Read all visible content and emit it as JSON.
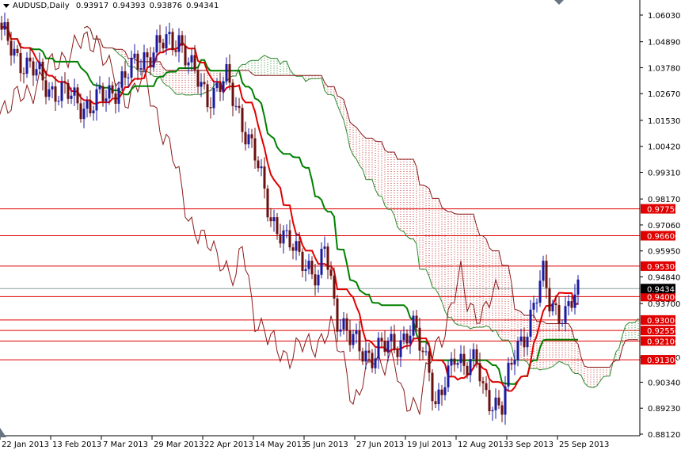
{
  "header": {
    "symbol": "AUDUSD,Daily",
    "open": "0.93917",
    "high": "0.94393",
    "low": "0.93876",
    "close": "0.94341"
  },
  "chart_data": {
    "type": "candlestick",
    "title": "AUDUSD,Daily",
    "indicator": "Ichimoku Kinko Hyo",
    "ylim": [
      0.8812,
      1.0603
    ],
    "y_ticks": [
      "1.06030",
      "1.04890",
      "1.03780",
      "1.02670",
      "1.01530",
      "1.00420",
      "0.99310",
      "0.98170",
      "0.97060",
      "0.95950",
      "0.94840",
      "0.93700",
      "0.91400",
      "0.90340",
      "0.89230",
      "0.88120"
    ],
    "x_labels": [
      "22 Jan 2013",
      "13 Feb 2013",
      "7 Mar 2013",
      "29 Mar 2013",
      "22 Apr 2013",
      "14 May 2013",
      "5 Jun 2013",
      "27 Jun 2013",
      "19 Jul 2013",
      "12 Aug 2013",
      "3 Sep 2013",
      "25 Sep 2013"
    ],
    "bars_per_label": 16,
    "bar_count": 184,
    "close_keypoints": [
      [
        0,
        1.0515
      ],
      [
        5,
        1.043
      ],
      [
        15,
        1.0295
      ],
      [
        28,
        1.021
      ],
      [
        33,
        1.026
      ],
      [
        40,
        1.035
      ],
      [
        45,
        1.043
      ],
      [
        56,
        1.051
      ],
      [
        60,
        1.036
      ],
      [
        65,
        1.026
      ],
      [
        71,
        1.032
      ],
      [
        75,
        1.019
      ],
      [
        80,
        0.999
      ],
      [
        85,
        0.975
      ],
      [
        90,
        0.962
      ],
      [
        95,
        0.958
      ],
      [
        100,
        0.945
      ],
      [
        102,
        0.962
      ],
      [
        106,
        0.932
      ],
      [
        110,
        0.921
      ],
      [
        117,
        0.915
      ],
      [
        125,
        0.921
      ],
      [
        130,
        0.925
      ],
      [
        135,
        0.911
      ],
      [
        137,
        0.894
      ],
      [
        141,
        0.904
      ],
      [
        143,
        0.915
      ],
      [
        150,
        0.911
      ],
      [
        152,
        0.898
      ],
      [
        158,
        0.894
      ],
      [
        162,
        0.915
      ],
      [
        166,
        0.928
      ],
      [
        171,
        0.948
      ],
      [
        173,
        0.938
      ],
      [
        178,
        0.932
      ],
      [
        183,
        0.94341
      ]
    ],
    "last_bar": {
      "open": 0.93917,
      "high": 0.94393,
      "low": 0.93876,
      "close": 0.94341
    },
    "current_price": {
      "value": 0.94341,
      "label": "0.94341",
      "color": "#000000"
    },
    "levels": [
      {
        "value": 0.9775,
        "label": "0.97750"
      },
      {
        "value": 0.966,
        "label": "0.96600"
      },
      {
        "value": 0.953,
        "label": "0.95300"
      },
      {
        "value": 0.94,
        "label": "0.94000"
      },
      {
        "value": 0.93,
        "label": "0.93000"
      },
      {
        "value": 0.9255,
        "label": "0.92550"
      },
      {
        "value": 0.921,
        "label": "0.92100"
      },
      {
        "value": 0.913,
        "label": "0.91300"
      }
    ],
    "colors": {
      "level": "#e00000",
      "bull": "#1a1aa0",
      "bear": "#6b0f0f",
      "tenkan": "#e00000",
      "kijun": "#008000",
      "chikou": "#8b1a1a",
      "cloud_up": "#2e8b2e",
      "cloud_down": "#c03030",
      "axis": "#000000"
    }
  }
}
